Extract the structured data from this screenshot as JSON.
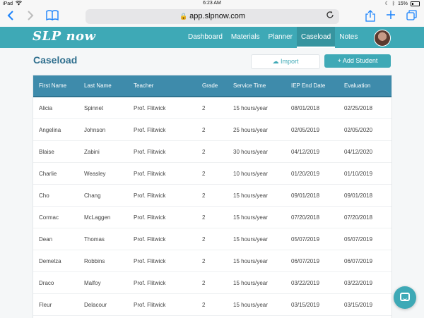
{
  "statusbar": {
    "left": "iPad",
    "time": "6:23 AM",
    "battery": "15%"
  },
  "browser": {
    "url": "app.slpnow.com"
  },
  "app": {
    "logo": "SLP now",
    "nav": [
      {
        "label": "Dashboard"
      },
      {
        "label": "Materials"
      },
      {
        "label": "Planner"
      },
      {
        "label": "Caseload",
        "active": true
      },
      {
        "label": "Notes"
      }
    ]
  },
  "page": {
    "title": "Caseload",
    "import_label": "Import",
    "add_label": "+ Add Student"
  },
  "table": {
    "columns": [
      "First Name",
      "Last Name",
      "Teacher",
      "Grade",
      "Service Time",
      "IEP End Date",
      "Evaluation"
    ],
    "rows": [
      [
        "Alicia",
        "Spinnet",
        "Prof. Flitwick",
        "2",
        "15 hours/year",
        "08/01/2018",
        "02/25/2018"
      ],
      [
        "Angelina",
        "Johnson",
        "Prof. Flitwick",
        "2",
        "25 hours/year",
        "02/05/2019",
        "02/05/2020"
      ],
      [
        "Blaise",
        "Zabini",
        "Prof. Flitwick",
        "2",
        "30 hours/year",
        "04/12/2019",
        "04/12/2020"
      ],
      [
        "Charlie",
        "Weasley",
        "Prof. Flitwick",
        "2",
        "10 hours/year",
        "01/20/2019",
        "01/10/2019"
      ],
      [
        "Cho",
        "Chang",
        "Prof. Flitwick",
        "2",
        "15 hours/year",
        "09/01/2018",
        "09/01/2018"
      ],
      [
        "Cormac",
        "McLaggen",
        "Prof. Flitwick",
        "2",
        "15 hours/year",
        "07/20/2018",
        "07/20/2018"
      ],
      [
        "Dean",
        "Thomas",
        "Prof. Flitwick",
        "2",
        "15 hours/year",
        "05/07/2019",
        "05/07/2019"
      ],
      [
        "Demelza",
        "Robbins",
        "Prof. Flitwick",
        "2",
        "15 hours/year",
        "06/07/2019",
        "06/07/2019"
      ],
      [
        "Draco",
        "Malfoy",
        "Prof. Flitwick",
        "2",
        "15 hours/year",
        "03/22/2019",
        "03/22/2019"
      ],
      [
        "Fleur",
        "Delacour",
        "Prof. Flitwick",
        "2",
        "15 hours/year",
        "03/15/2019",
        "03/15/2019"
      ]
    ]
  },
  "icons": {
    "back": "chevron-left-icon",
    "forward": "chevron-right-icon",
    "bookmarks": "book-icon",
    "reload": "reload-icon",
    "share": "share-icon",
    "new_tab": "plus-icon",
    "tabs": "tabs-icon",
    "chat": "chat-icon"
  },
  "colors": {
    "brand": "#3ea9b6",
    "table_header": "#3e8bab",
    "title": "#2f6f8e"
  }
}
